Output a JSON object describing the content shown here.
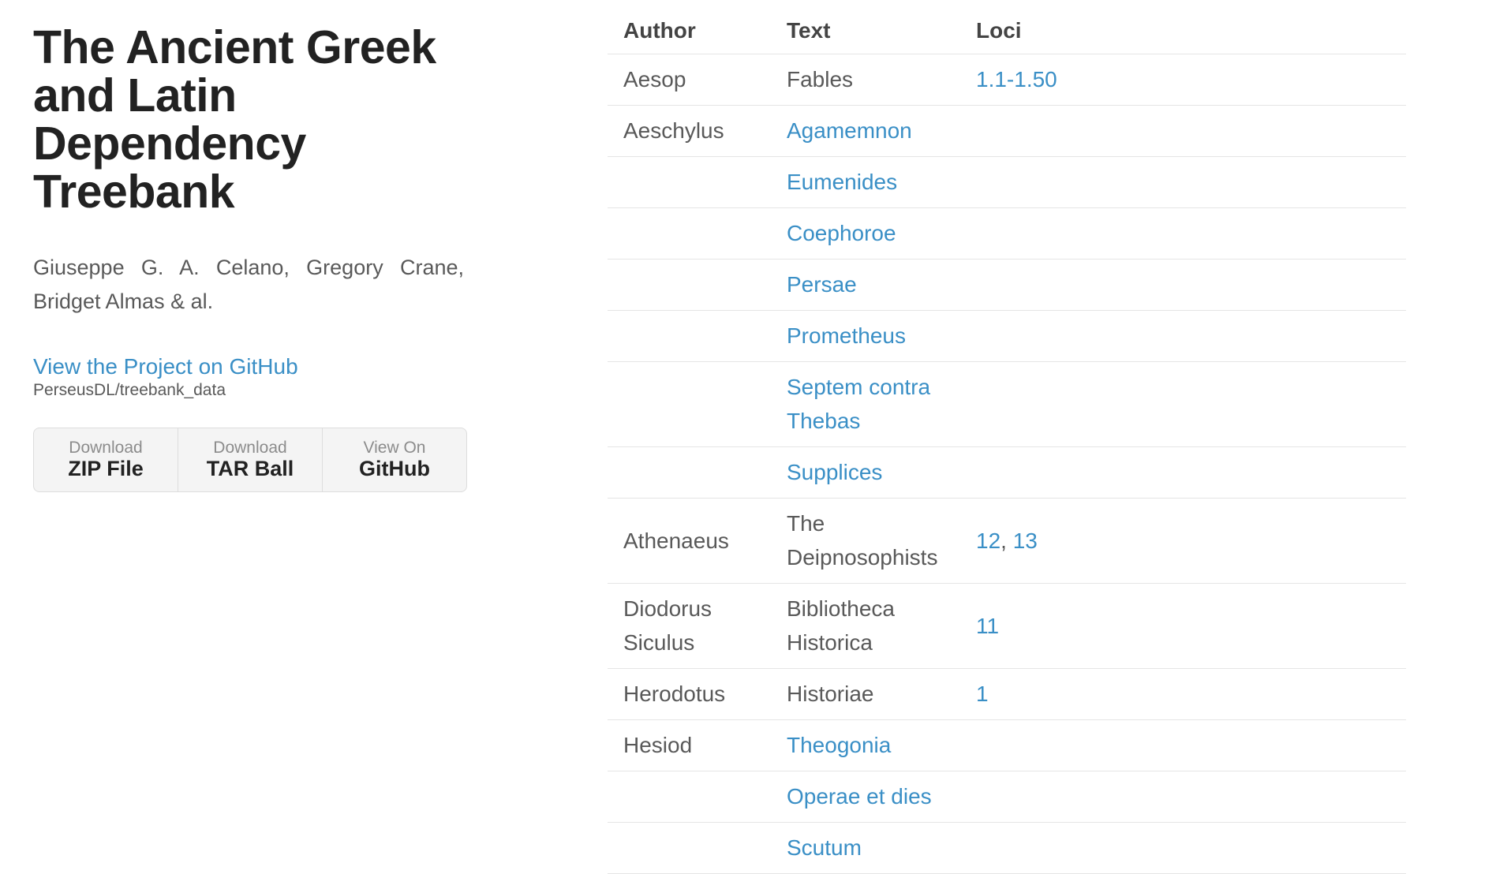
{
  "header": {
    "title": "The Ancient Greek and Latin Dependency Treebank",
    "authors": "Giuseppe G. A. Celano, Gregory Crane, Bridget Almas & al.",
    "github_link": "View the Project on GitHub",
    "repo_path": "PerseusDL/treebank_data"
  },
  "downloads": [
    {
      "small": "Download",
      "big": "ZIP File"
    },
    {
      "small": "Download",
      "big": "TAR Ball"
    },
    {
      "small": "View On",
      "big": "GitHub"
    }
  ],
  "table": {
    "headers": [
      "Author",
      "Text",
      "Loci"
    ],
    "rows": [
      {
        "author": "Aesop",
        "text": "Fables",
        "text_link": false,
        "loci": [
          "1.1-1.50"
        ]
      },
      {
        "author": "Aeschylus",
        "text": "Agamemnon",
        "text_link": true,
        "loci": []
      },
      {
        "author": "",
        "text": "Eumenides",
        "text_link": true,
        "loci": []
      },
      {
        "author": "",
        "text": "Coephoroe",
        "text_link": true,
        "loci": []
      },
      {
        "author": "",
        "text": "Persae",
        "text_link": true,
        "loci": []
      },
      {
        "author": "",
        "text": "Prometheus",
        "text_link": true,
        "loci": []
      },
      {
        "author": "",
        "text": "Septem contra Thebas",
        "text_link": true,
        "loci": []
      },
      {
        "author": "",
        "text": "Supplices",
        "text_link": true,
        "loci": []
      },
      {
        "author": "Athenaeus",
        "text": "The Deipnosophists",
        "text_link": false,
        "loci": [
          "12",
          "13"
        ]
      },
      {
        "author": "Diodorus Siculus",
        "text": "Bibliotheca Historica",
        "text_link": false,
        "loci": [
          "11"
        ]
      },
      {
        "author": "Herodotus",
        "text": "Historiae",
        "text_link": false,
        "loci": [
          "1"
        ]
      },
      {
        "author": "Hesiod",
        "text": "Theogonia",
        "text_link": true,
        "loci": []
      },
      {
        "author": "",
        "text": "Operae et dies",
        "text_link": true,
        "loci": []
      },
      {
        "author": "",
        "text": "Scutum",
        "text_link": true,
        "loci": []
      }
    ]
  },
  "colors": {
    "link": "#3a8fc6",
    "title": "#222222",
    "body_text": "#595959",
    "row_border": "#e5e5e5"
  }
}
